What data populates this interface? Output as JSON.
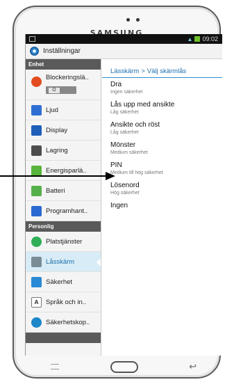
{
  "device": {
    "brand": "SAMSUNG"
  },
  "statusbar": {
    "time": "09:02"
  },
  "header": {
    "title": "Inställningar"
  },
  "sidebar": {
    "sections": [
      {
        "label": "Enhet",
        "items": [
          {
            "label": "Blockeringslä..",
            "icon": "block-icon",
            "toggle": "O"
          },
          {
            "label": "Ljud",
            "icon": "speaker-icon"
          },
          {
            "label": "Display",
            "icon": "display-icon"
          },
          {
            "label": "Lagring",
            "icon": "storage-icon"
          },
          {
            "label": "Energisparlä..",
            "icon": "power-saving-icon"
          },
          {
            "label": "Batteri",
            "icon": "battery-icon"
          },
          {
            "label": "Programhant..",
            "icon": "apps-icon"
          }
        ]
      },
      {
        "label": "Personlig",
        "items": [
          {
            "label": "Platstjänster",
            "icon": "location-icon"
          },
          {
            "label": "Låsskärm",
            "icon": "lock-screen-icon",
            "selected": true
          },
          {
            "label": "Säkerhet",
            "icon": "security-icon"
          },
          {
            "label": "Språk och in..",
            "icon": "language-icon",
            "glyph": "A"
          },
          {
            "label": "Säkerhetskop..",
            "icon": "backup-icon"
          }
        ]
      }
    ]
  },
  "main": {
    "breadcrumb": {
      "parent": "Lässkärm",
      "separator": ">",
      "current": "Välj skärmlås"
    },
    "options": [
      {
        "title": "Dra",
        "subtitle": "Ingen säkerhet"
      },
      {
        "title": "Lås upp med ansikte",
        "subtitle": "Låg säkerhet"
      },
      {
        "title": "Ansikte och röst",
        "subtitle": "Låg säkerhet"
      },
      {
        "title": "Mönster",
        "subtitle": "Medium säkerhet"
      },
      {
        "title": "PIN",
        "subtitle": "Medium till hög säkerhet"
      },
      {
        "title": "Lösenord",
        "subtitle": "Hög säkerhet"
      },
      {
        "title": "Ingen",
        "subtitle": ""
      }
    ]
  },
  "colors": {
    "accent": "#1b6fae",
    "header_bar": "#5a5a5a",
    "selected_bg": "#d8ecf7"
  }
}
